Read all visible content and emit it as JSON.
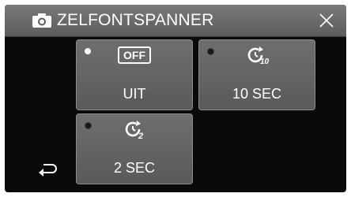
{
  "header": {
    "title": "ZELFONTSPANNER",
    "camera_icon": "camera-icon",
    "close_icon": "close-icon"
  },
  "options": [
    {
      "id": "off",
      "badge": "OFF",
      "label": "UIT",
      "selected": true
    },
    {
      "id": "10sec",
      "timer_digits": "10",
      "label": "10 SEC",
      "selected": false
    },
    {
      "id": "2sec",
      "timer_digits": "2",
      "label": "2 SEC",
      "selected": false
    }
  ],
  "footer": {
    "back_icon": "back-arrow-icon"
  },
  "colors": {
    "background": "#0a0a0a",
    "tile": "#666666",
    "header": "#6b6b6b",
    "text": "#ffffff"
  }
}
